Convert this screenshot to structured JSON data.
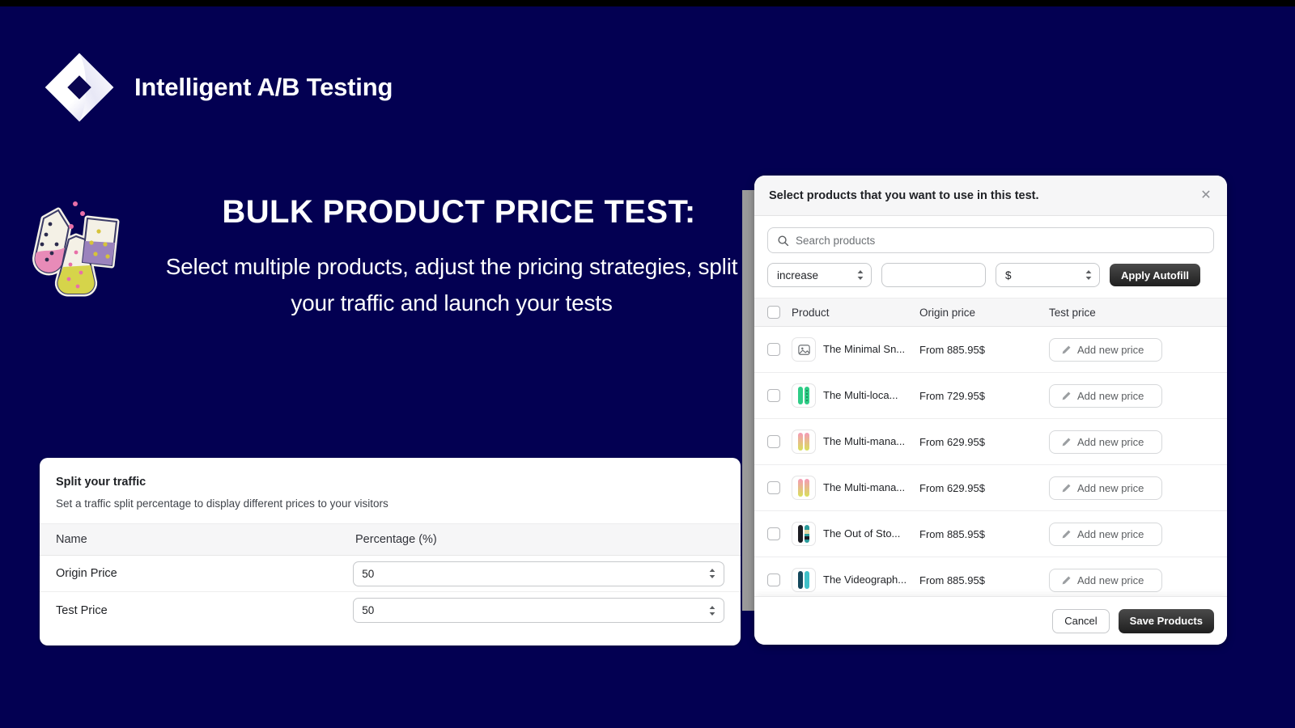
{
  "theme": {
    "background": "#030052",
    "accent_dark": "#1f1f1f",
    "panel": "#ffffff"
  },
  "brand": {
    "title": "Intelligent A/B Testing",
    "logo_icon": "diamond-logo-icon"
  },
  "hero": {
    "illustration_icon": "lab-flasks-icon",
    "heading": "BULK PRODUCT PRICE TEST:",
    "subheading": "Select multiple products, adjust the pricing strategies, split your traffic and launch your tests"
  },
  "split_card": {
    "title": "Split your traffic",
    "description": "Set a traffic split percentage to display different prices to your visitors",
    "columns": [
      "Name",
      "Percentage (%)"
    ],
    "rows": [
      {
        "name": "Origin Price",
        "percentage": "50"
      },
      {
        "name": "Test Price",
        "percentage": "50"
      }
    ]
  },
  "modal": {
    "title": "Select products that you want to use in this test.",
    "close_icon": "close-icon",
    "search": {
      "placeholder": "Search products",
      "icon": "search-icon",
      "value": ""
    },
    "autofill": {
      "operation": "increase",
      "amount": "",
      "unit": "$",
      "button_label": "Apply Autofill"
    },
    "table": {
      "columns": [
        "Product",
        "Origin price",
        "Test price"
      ],
      "rows": [
        {
          "product": "The Minimal Sn...",
          "origin_price": "From 885.95$",
          "test_price_label": "Add new price",
          "thumb": "placeholder"
        },
        {
          "product": "The Multi-loca...",
          "origin_price": "From 729.95$",
          "test_price_label": "Add new price",
          "thumb": "green-board"
        },
        {
          "product": "The Multi-mana...",
          "origin_price": "From 629.95$",
          "test_price_label": "Add new price",
          "thumb": "pink-skis"
        },
        {
          "product": "The Multi-mana...",
          "origin_price": "From 629.95$",
          "test_price_label": "Add new price",
          "thumb": "pink-skis"
        },
        {
          "product": "The Out of Sto...",
          "origin_price": "From 885.95$",
          "test_price_label": "Add new price",
          "thumb": "dark-board"
        },
        {
          "product": "The Videograph...",
          "origin_price": "From 885.95$",
          "test_price_label": "Add new price",
          "thumb": "teal-board"
        }
      ]
    },
    "footer": {
      "cancel_label": "Cancel",
      "save_label": "Save Products"
    }
  }
}
